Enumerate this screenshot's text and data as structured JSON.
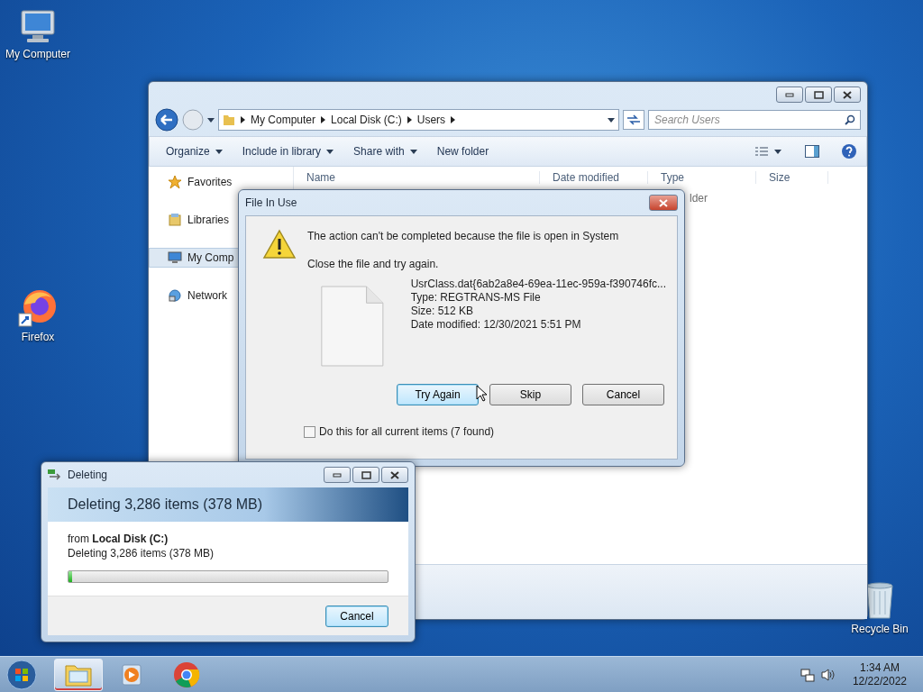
{
  "desktop_icons": [
    {
      "label": "My Computer",
      "kind": "computer"
    },
    {
      "label": "Firefox",
      "kind": "browser"
    },
    {
      "label": "Recycle Bin",
      "kind": "bin"
    }
  ],
  "explorer": {
    "breadcrumb": [
      "My Computer",
      "Local Disk (C:)",
      "Users"
    ],
    "search": {
      "placeholder": "Search Users"
    },
    "toolbar": [
      {
        "label": "Organize",
        "dropdown": true
      },
      {
        "label": "Include in library",
        "dropdown": true
      },
      {
        "label": "Share with",
        "dropdown": true
      },
      {
        "label": "New folder",
        "dropdown": false
      }
    ],
    "nav": [
      {
        "label": "Favorites",
        "kind": "star",
        "selected": false
      },
      {
        "label": "Libraries",
        "kind": "library",
        "selected": false
      },
      {
        "label": "My Comp",
        "kind": "computer",
        "selected": true
      },
      {
        "label": "Network",
        "kind": "network",
        "selected": false
      }
    ],
    "columns": [
      "Name",
      "Date modified",
      "Type",
      "Size"
    ],
    "rows": [
      {
        "type": "lder"
      }
    ]
  },
  "file_in_use": {
    "title": "File In Use",
    "message": "The action can't be completed because the file is open in System",
    "hint": "Close the file and try again.",
    "file_details": [
      "UsrClass.dat{6ab2a8e4-69ea-11ec-959a-f390746fc...",
      "Type: REGTRANS-MS File",
      "Size: 512 KB",
      "Date modified: 12/30/2021 5:51 PM"
    ],
    "buttons": [
      {
        "label": "Try Again",
        "default": true
      },
      {
        "label": "Skip",
        "default": false
      },
      {
        "label": "Cancel",
        "default": false
      }
    ],
    "checkbox": {
      "label": "Do this for all current items (7 found)",
      "checked": false
    }
  },
  "deleting": {
    "title": "Deleting",
    "header": "Deleting 3,286 items (378 MB)",
    "from": "from **Local Disk (C:)**",
    "detail": "Deleting 3,286 items (378 MB)",
    "progress": {
      "level": 0.01
    },
    "button": "Cancel"
  },
  "taskbar": {
    "apps": [
      {
        "kind": "explorer",
        "selected": true
      },
      {
        "kind": "media",
        "selected": false
      },
      {
        "kind": "chrome",
        "selected": false
      }
    ],
    "time": "1:34 AM",
    "date": "12/22/2022"
  }
}
